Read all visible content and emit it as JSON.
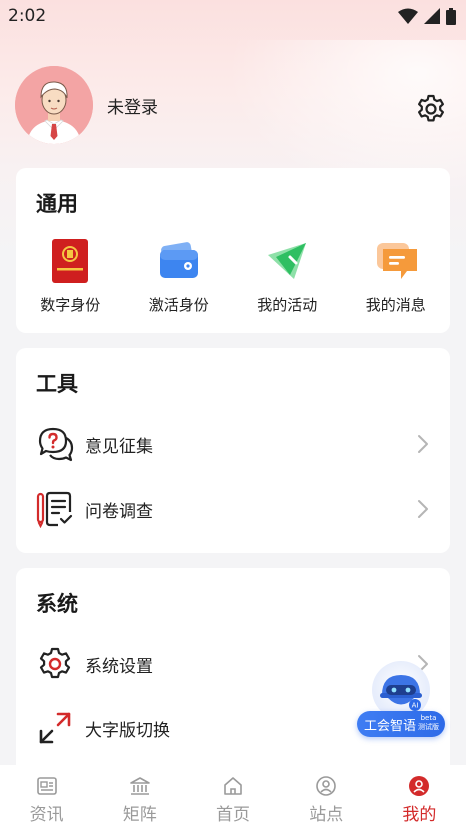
{
  "status_bar": {
    "time": "2:02"
  },
  "profile": {
    "login_label": "未登录"
  },
  "general": {
    "title": "通用",
    "items": [
      {
        "label": "数字身份",
        "icon": "digital-id-badge-icon"
      },
      {
        "label": "激活身份",
        "icon": "wallet-card-icon"
      },
      {
        "label": "我的活动",
        "icon": "flag-icon"
      },
      {
        "label": "我的消息",
        "icon": "message-bubble-icon"
      }
    ]
  },
  "tools": {
    "title": "工具",
    "items": [
      {
        "label": "意见征集",
        "icon": "question-chat-icon"
      },
      {
        "label": "问卷调查",
        "icon": "survey-pen-icon"
      }
    ]
  },
  "system": {
    "title": "系统",
    "items": [
      {
        "label": "系统设置",
        "icon": "gear-icon"
      },
      {
        "label": "大字版切换",
        "icon": "expand-arrows-icon"
      }
    ]
  },
  "ai_assistant": {
    "label": "工会智语",
    "badge_top": "beta",
    "badge_bottom": "测试版",
    "mark": "AI"
  },
  "tabbar": {
    "active_index": 4,
    "tabs": [
      {
        "label": "资讯",
        "icon": "news-icon"
      },
      {
        "label": "矩阵",
        "icon": "bank-building-icon"
      },
      {
        "label": "首页",
        "icon": "home-icon"
      },
      {
        "label": "站点",
        "icon": "user-circle-icon"
      },
      {
        "label": "我的",
        "icon": "profile-circle-icon"
      }
    ]
  },
  "colors": {
    "accent": "#d32b2b",
    "ai_blue": "#2d6ae8",
    "background": "#f4f4f6"
  }
}
